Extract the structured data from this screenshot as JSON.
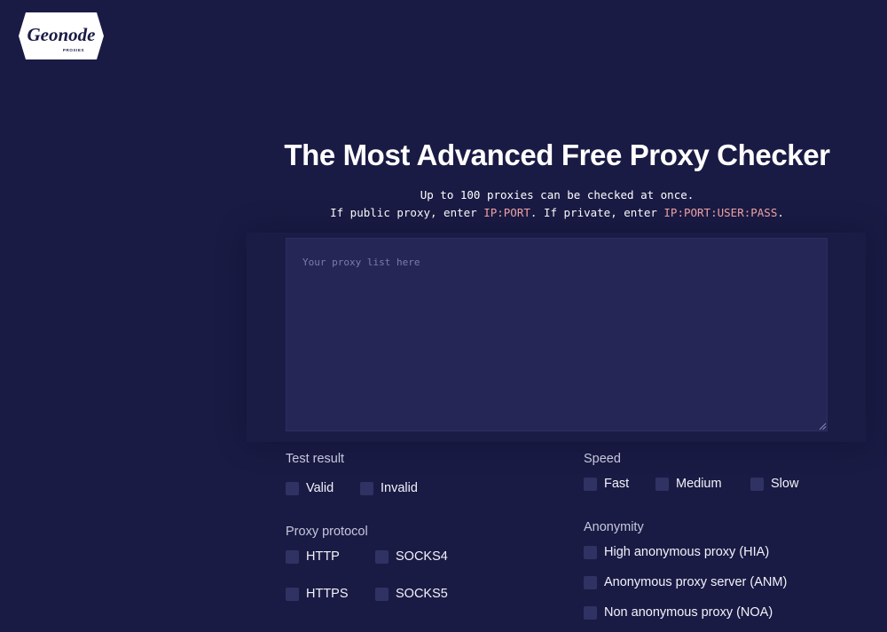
{
  "logo": {
    "brand": "Geonode",
    "tagline": "PROXIES"
  },
  "page": {
    "title": "The Most Advanced Free Proxy Checker",
    "subtitle_line1": "Up to 100 proxies can be checked at once.",
    "subtitle_line2_prefix": "If public proxy, enter ",
    "subtitle_public_format": "IP:PORT",
    "subtitle_line2_middle": ". If private, enter ",
    "subtitle_private_format": "IP:PORT:USER:PASS",
    "subtitle_line2_suffix": "."
  },
  "proxy_input": {
    "value": "",
    "placeholder": "Your proxy list here"
  },
  "filters": {
    "test_result": {
      "label": "Test result",
      "options": [
        {
          "label": "Valid",
          "checked": false
        },
        {
          "label": "Invalid",
          "checked": false
        }
      ]
    },
    "speed": {
      "label": "Speed",
      "options": [
        {
          "label": "Fast",
          "checked": false
        },
        {
          "label": "Medium",
          "checked": false
        },
        {
          "label": "Slow",
          "checked": false
        }
      ]
    },
    "proxy_protocol": {
      "label": "Proxy protocol",
      "options": [
        {
          "label": "HTTP",
          "checked": false
        },
        {
          "label": "SOCKS4",
          "checked": false
        },
        {
          "label": "HTTPS",
          "checked": false
        },
        {
          "label": "SOCKS5",
          "checked": false
        }
      ]
    },
    "anonymity": {
      "label": "Anonymity",
      "options": [
        {
          "label": "High anonymous proxy (HIA)",
          "checked": false
        },
        {
          "label": "Anonymous proxy server (ANM)",
          "checked": false
        },
        {
          "label": "Non anonymous proxy (NOA)",
          "checked": false
        }
      ]
    }
  },
  "colors": {
    "background": "#1a1b44",
    "textarea_bg": "#252656",
    "checkbox_bg": "#303263",
    "highlight": "#f2a6a6"
  }
}
